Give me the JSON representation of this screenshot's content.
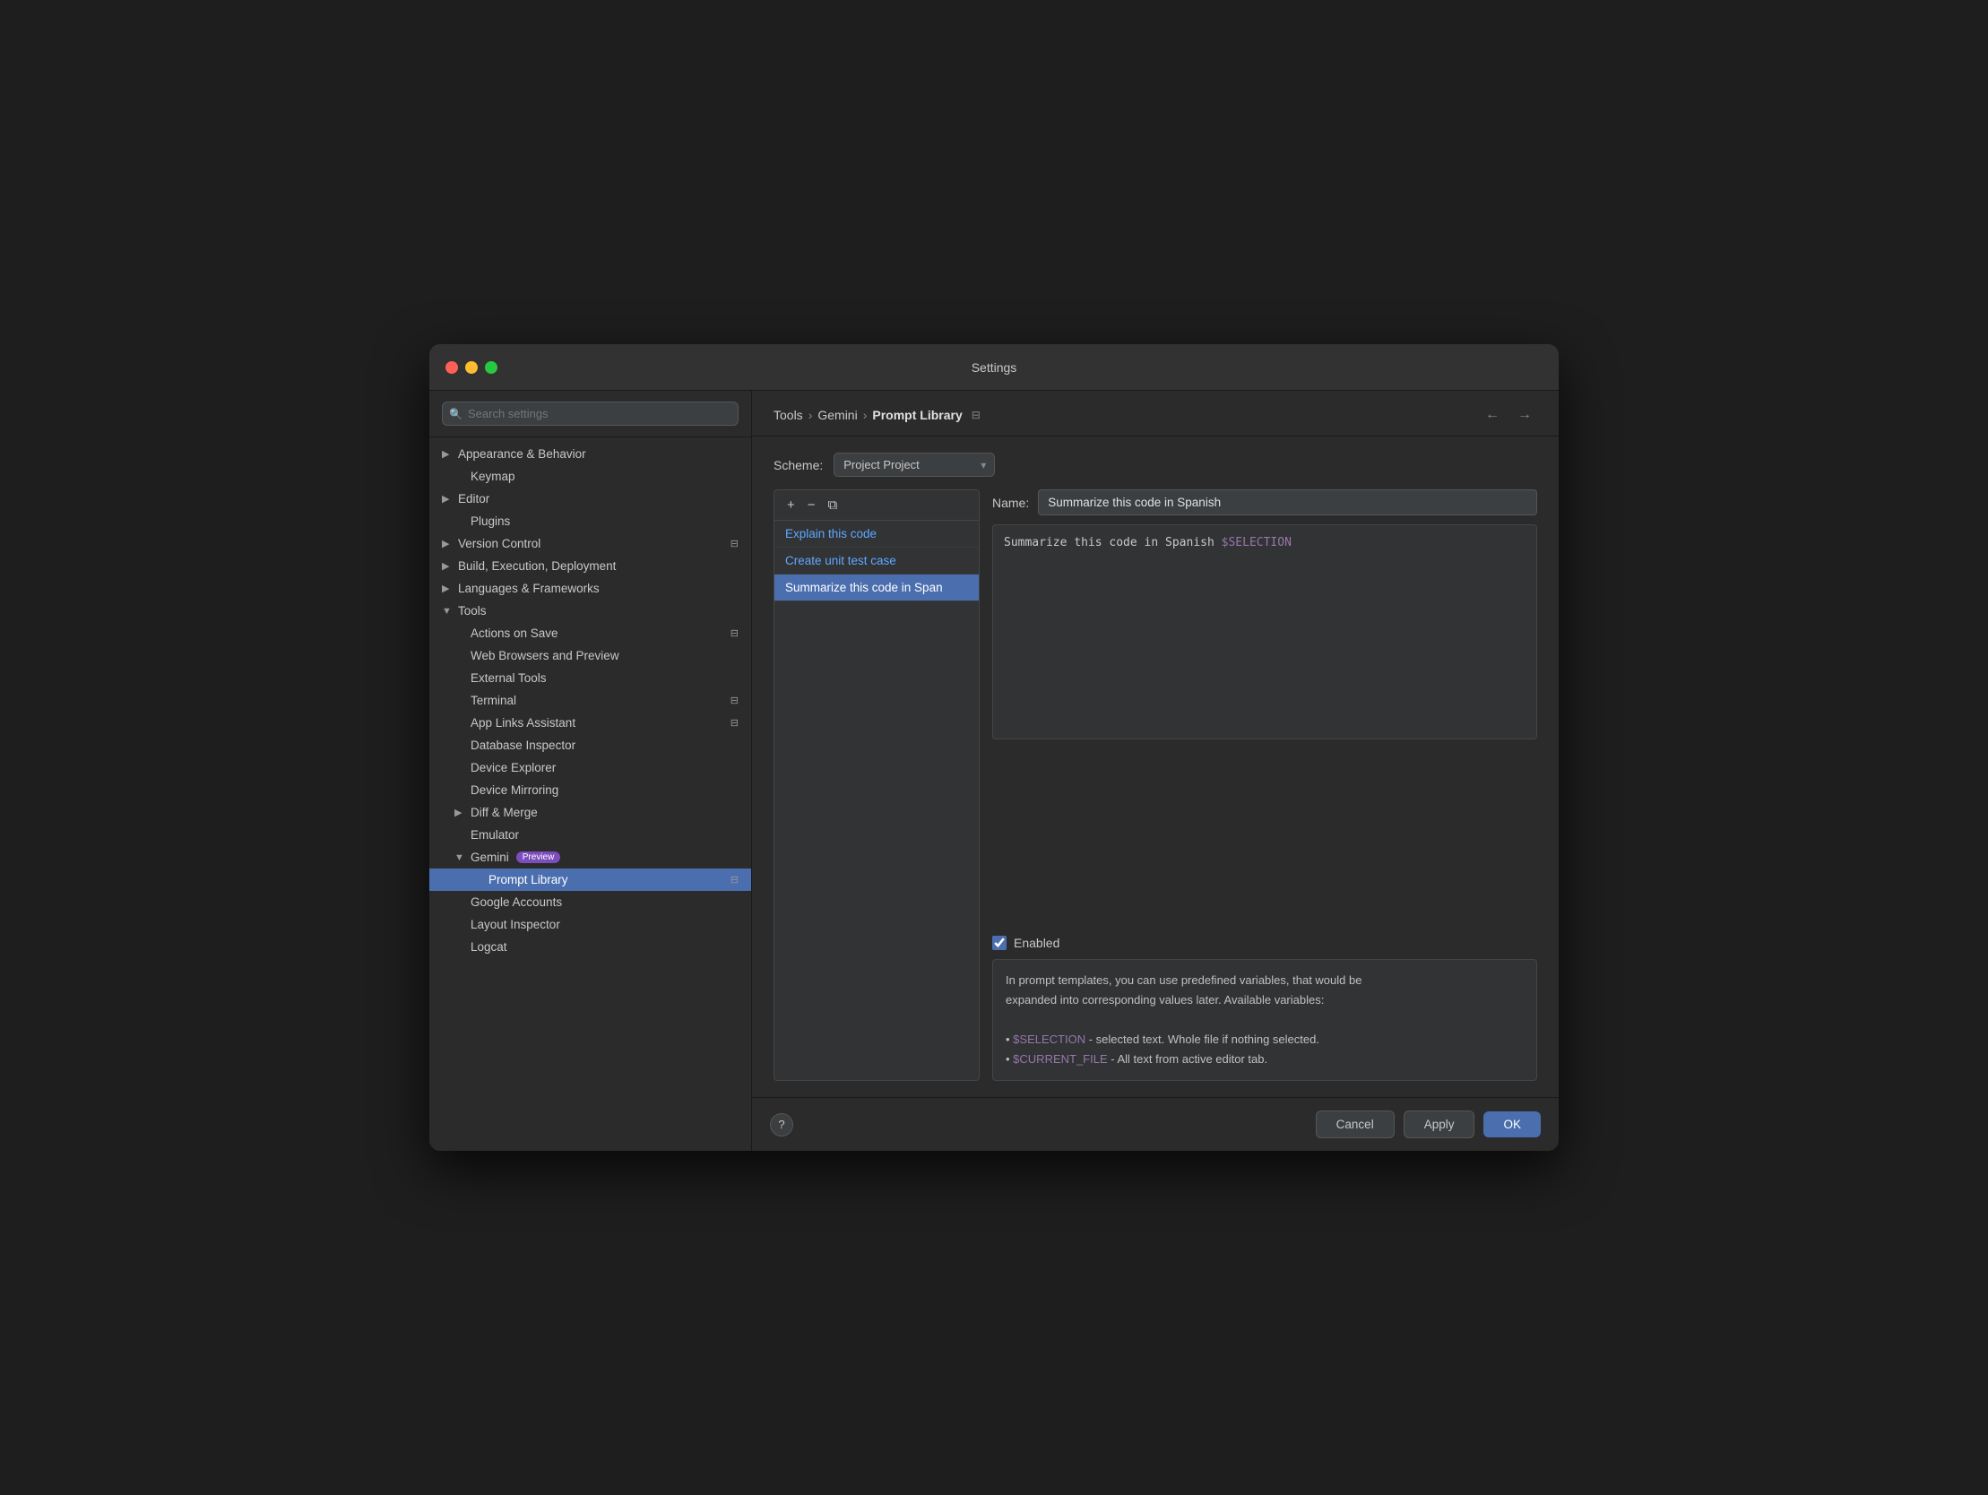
{
  "window": {
    "title": "Settings"
  },
  "breadcrumb": {
    "part1": "Tools",
    "part2": "Gemini",
    "part3": "Prompt Library",
    "icon": "⊟"
  },
  "scheme": {
    "label": "Scheme:",
    "value": "Project",
    "placeholder": "Project"
  },
  "sidebar": {
    "search_placeholder": "🔍",
    "items": [
      {
        "id": "appearance",
        "label": "Appearance & Behavior",
        "indent": 0,
        "chevron": "▶",
        "hasChevron": true
      },
      {
        "id": "keymap",
        "label": "Keymap",
        "indent": 1,
        "hasChevron": false
      },
      {
        "id": "editor",
        "label": "Editor",
        "indent": 0,
        "chevron": "▶",
        "hasChevron": true
      },
      {
        "id": "plugins",
        "label": "Plugins",
        "indent": 1,
        "hasChevron": false
      },
      {
        "id": "version-control",
        "label": "Version Control",
        "indent": 0,
        "chevron": "▶",
        "hasChevron": true,
        "hasPageIcon": true
      },
      {
        "id": "build",
        "label": "Build, Execution, Deployment",
        "indent": 0,
        "chevron": "▶",
        "hasChevron": true
      },
      {
        "id": "languages",
        "label": "Languages & Frameworks",
        "indent": 0,
        "chevron": "▶",
        "hasChevron": true
      },
      {
        "id": "tools",
        "label": "Tools",
        "indent": 0,
        "chevron": "▼",
        "hasChevron": true,
        "open": true
      },
      {
        "id": "actions-on-save",
        "label": "Actions on Save",
        "indent": 1,
        "hasChevron": false,
        "hasPageIcon": true
      },
      {
        "id": "web-browsers",
        "label": "Web Browsers and Preview",
        "indent": 1,
        "hasChevron": false
      },
      {
        "id": "external-tools",
        "label": "External Tools",
        "indent": 1,
        "hasChevron": false
      },
      {
        "id": "terminal",
        "label": "Terminal",
        "indent": 1,
        "hasChevron": false,
        "hasPageIcon": true
      },
      {
        "id": "app-links",
        "label": "App Links Assistant",
        "indent": 1,
        "hasChevron": false,
        "hasPageIcon": true
      },
      {
        "id": "database-inspector",
        "label": "Database Inspector",
        "indent": 1,
        "hasChevron": false
      },
      {
        "id": "device-explorer",
        "label": "Device Explorer",
        "indent": 1,
        "hasChevron": false
      },
      {
        "id": "device-mirroring",
        "label": "Device Mirroring",
        "indent": 1,
        "hasChevron": false
      },
      {
        "id": "diff-merge",
        "label": "Diff & Merge",
        "indent": 1,
        "chevron": "▶",
        "hasChevron": true
      },
      {
        "id": "emulator",
        "label": "Emulator",
        "indent": 1,
        "hasChevron": false
      },
      {
        "id": "gemini",
        "label": "Gemini",
        "indent": 1,
        "chevron": "▼",
        "hasChevron": true,
        "hasBadge": true,
        "badge": "Preview"
      },
      {
        "id": "prompt-library",
        "label": "Prompt Library",
        "indent": 2,
        "hasChevron": false,
        "selected": true,
        "hasPageIcon": true
      },
      {
        "id": "google-accounts",
        "label": "Google Accounts",
        "indent": 1,
        "hasChevron": false
      },
      {
        "id": "layout-inspector",
        "label": "Layout Inspector",
        "indent": 1,
        "hasChevron": false
      },
      {
        "id": "logcat",
        "label": "Logcat",
        "indent": 1,
        "hasChevron": false
      }
    ]
  },
  "toolbar": {
    "add_label": "+",
    "remove_label": "−",
    "copy_label": "⧉"
  },
  "prompt_list": {
    "items": [
      {
        "id": "explain",
        "label": "Explain this code",
        "selected": false
      },
      {
        "id": "unit-test",
        "label": "Create unit test case",
        "selected": false
      },
      {
        "id": "summarize",
        "label": "Summarize this code in Span",
        "selected": true
      }
    ]
  },
  "detail": {
    "name_label": "Name:",
    "name_value": "Summarize this code in Spanish",
    "prompt_text": "Summarize this code in Spanish ",
    "prompt_var": "$SELECTION",
    "enabled_label": "Enabled",
    "enabled": true
  },
  "info": {
    "text": "In prompt templates, you can use predefined variables, that would be\nexpanded into corresponding values later. Available variables:\n\n • $SELECTION - selected text. Whole file if nothing selected.\n • $CURRENT_FILE - All text from active editor tab."
  },
  "footer": {
    "cancel_label": "Cancel",
    "apply_label": "Apply",
    "ok_label": "OK",
    "help_label": "?"
  }
}
